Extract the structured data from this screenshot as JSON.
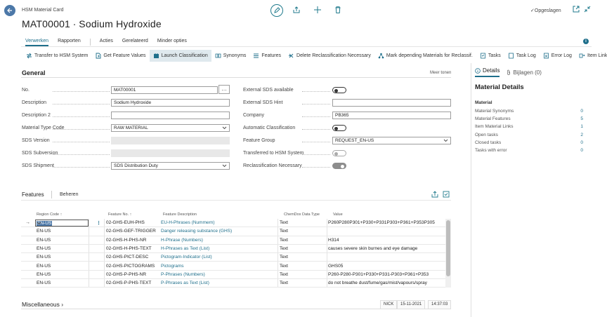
{
  "header": {
    "caption": "HSM Material Card",
    "title": "MAT00001 ∙ Sodium Hydroxide",
    "saved_status": "Opgeslagen"
  },
  "tabs": [
    {
      "label": "Verwerken",
      "active": true
    },
    {
      "label": "Rapporten",
      "active": false
    },
    {
      "label": "Acties",
      "active": false
    },
    {
      "label": "Gerelateerd",
      "active": false
    },
    {
      "label": "Minder opties",
      "active": false
    }
  ],
  "actions": [
    {
      "label": "Transfer to HSM System",
      "icon": "transfer-icon",
      "selected": false
    },
    {
      "label": "Get Feature Values",
      "icon": "document-icon",
      "selected": false
    },
    {
      "label": "Launch Classification",
      "icon": "classification-icon",
      "selected": true
    },
    {
      "label": "Synonyms",
      "icon": "synonyms-icon",
      "selected": false
    },
    {
      "label": "Features",
      "icon": "list-icon",
      "selected": false
    },
    {
      "label": "Delete Reclassification Necessary",
      "icon": "delete-icon",
      "selected": false
    },
    {
      "label": "Mark depending Materials for Reclassif.",
      "icon": "tree-icon",
      "selected": false
    },
    {
      "label": "Tasks",
      "icon": "tasks-icon",
      "selected": false
    },
    {
      "label": "Task Log",
      "icon": "log-icon",
      "selected": false
    },
    {
      "label": "Error Log",
      "icon": "error-log-icon",
      "selected": false
    },
    {
      "label": "Item Link",
      "icon": "link-icon",
      "selected": false
    }
  ],
  "general": {
    "title": "General",
    "more_label": "Meer tonen",
    "left_fields": [
      {
        "label": "No.",
        "value": "MAT00001",
        "kind": "text"
      },
      {
        "label": "Description",
        "value": "Sodium Hydroxide",
        "kind": "text"
      },
      {
        "label": "Description 2",
        "value": "",
        "kind": "text"
      },
      {
        "label": "Material Type Code",
        "value": "RAW MATERIAL",
        "kind": "combo"
      },
      {
        "label": "SDS Version",
        "value": "",
        "kind": "readonly"
      },
      {
        "label": "SDS Subversion",
        "value": "",
        "kind": "readonly"
      },
      {
        "label": "SDS Shipment",
        "value": "SDS Distribution Duty",
        "kind": "select"
      }
    ],
    "right_fields": [
      {
        "label": "External SDS available",
        "value": "",
        "kind": "toggle",
        "state": "off"
      },
      {
        "label": "External SDS Hint",
        "value": "",
        "kind": "text"
      },
      {
        "label": "Company",
        "value": "PB365",
        "kind": "text"
      },
      {
        "label": "Automatic Classification",
        "value": "",
        "kind": "toggle",
        "state": "off"
      },
      {
        "label": "Feature Group",
        "value": "REQUEST_EN-US",
        "kind": "combo"
      },
      {
        "label": "Transferred to HSM System",
        "value": "",
        "kind": "toggle",
        "state": "disabled"
      },
      {
        "label": "Reclassification Necessary",
        "value": "",
        "kind": "toggle",
        "state": "on-disabled"
      }
    ]
  },
  "factbox": {
    "tab_details": "Details",
    "tab_attachments": "Bijlagen (0)",
    "heading": "Material Details",
    "group": "Material",
    "rows": [
      {
        "label": "Material Synonyms",
        "value": "0"
      },
      {
        "label": "Material Features",
        "value": "5"
      },
      {
        "label": "Item Material Links",
        "value": "1"
      },
      {
        "label": "Open tasks",
        "value": "2"
      },
      {
        "label": "Closed tasks",
        "value": "0"
      },
      {
        "label": "Tasks with error",
        "value": "0"
      }
    ]
  },
  "features": {
    "title": "Features",
    "manage_label": "Beheren",
    "columns": [
      "Region Code ↑",
      "Feature No. ↑",
      "Feature Description",
      "ChemDox Data Type",
      "Value"
    ],
    "rows": [
      {
        "region": "EN-US",
        "no": "02-GHS-EUH-PHS",
        "desc": "EU-H-Phrases (Nummern)",
        "type": "Text",
        "value": "P260P280P301+P330+P331P303+P361+P353P305"
      },
      {
        "region": "EN-US",
        "no": "02-GHS-GEF-TRIGGER",
        "desc": "Danger releasing substance (GHS)",
        "type": "Text",
        "value": ""
      },
      {
        "region": "EN-US",
        "no": "02-GHS-H-PHS-NR",
        "desc": "H-Phrase (Numbers)",
        "type": "Text",
        "value": "H314"
      },
      {
        "region": "EN-US",
        "no": "02-GHS-H-PHS-TEXT",
        "desc": "H-Phrases as Text (List)",
        "type": "Text",
        "value": "causes severe skin burnes and eye damage"
      },
      {
        "region": "EN-US",
        "no": "02-GHS-PICT-DESC",
        "desc": "Pictogram-Indicator (List)",
        "type": "Text",
        "value": ""
      },
      {
        "region": "EN-US",
        "no": "02-GHS-PICTOGRAMS",
        "desc": "Pictograms",
        "type": "Text",
        "value": "GHS05"
      },
      {
        "region": "EN-US",
        "no": "02-GHS-P-PHS-NR",
        "desc": "P-Phrases (Numbers)",
        "type": "Text",
        "value": "P260-P280-P301+P330+P331-P303+P361+P353"
      },
      {
        "region": "EN-US",
        "no": "02-GHS-P-PHS-TEXT",
        "desc": "P-Phrases as Text (List)",
        "type": "Text",
        "value": "do not breathe dust/fume/gas/mist/vapours/spray"
      }
    ]
  },
  "misc": {
    "title": "Miscellaneous",
    "user": "NICK",
    "date": "15-11-2021",
    "time": "14:37:03"
  }
}
